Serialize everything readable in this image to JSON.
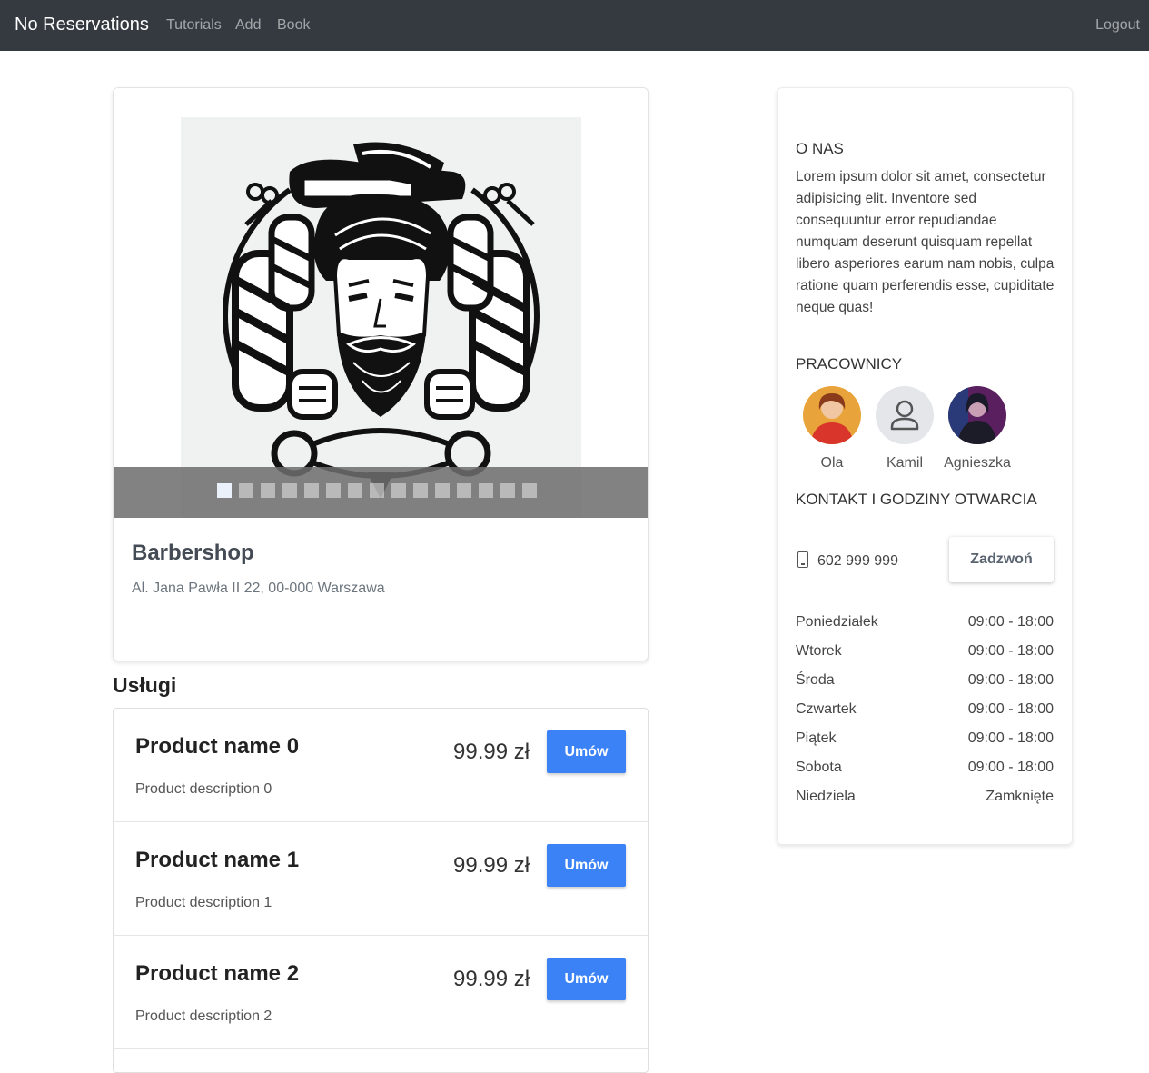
{
  "nav": {
    "brand": "No Reservations",
    "links": [
      "Tutorials",
      "Add",
      "Book"
    ],
    "logout": "Logout"
  },
  "shop": {
    "name": "Barbershop",
    "address": "Al. Jana Pawła II 22, 00-000 Warszawa",
    "carousel": {
      "slide_count": 15,
      "active_index": 0
    }
  },
  "services": {
    "title": "Usługi",
    "items": [
      {
        "name": "Product name 0",
        "description": "Product description 0",
        "price": "99.99 zł",
        "button": "Umów"
      },
      {
        "name": "Product name 1",
        "description": "Product description 1",
        "price": "99.99 zł",
        "button": "Umów"
      },
      {
        "name": "Product name 2",
        "description": "Product description 2",
        "price": "99.99 zł",
        "button": "Umów"
      }
    ]
  },
  "about": {
    "title": "O NAS",
    "text": "Lorem ipsum dolor sit amet, consectetur adipisicing elit. Inventore sed consequuntur error repudiandae numquam deserunt quisquam repellat libero asperiores earum nam nobis, culpa ratione quam perferendis esse, cupiditate neque quas!"
  },
  "workers": {
    "title": "PRACOWNICY",
    "items": [
      {
        "name": "Ola",
        "avatar": "photo"
      },
      {
        "name": "Kamil",
        "avatar": "person-icon"
      },
      {
        "name": "Agnieszka",
        "avatar": "photo"
      }
    ]
  },
  "contact": {
    "title": "KONTAKT I GODZINY OTWARCIA",
    "phone": "602 999 999",
    "call_button": "Zadzwoń",
    "hours": [
      {
        "day": "Poniedziałek",
        "time": "09:00 - 18:00"
      },
      {
        "day": "Wtorek",
        "time": "09:00 - 18:00"
      },
      {
        "day": "Środa",
        "time": "09:00 - 18:00"
      },
      {
        "day": "Czwartek",
        "time": "09:00 - 18:00"
      },
      {
        "day": "Piątek",
        "time": "09:00 - 18:00"
      },
      {
        "day": "Sobota",
        "time": "09:00 - 18:00"
      },
      {
        "day": "Niedziela",
        "time": "Zamknięte"
      }
    ]
  },
  "colors": {
    "navbar": "#343a40",
    "primary_button": "#3b82f6"
  }
}
